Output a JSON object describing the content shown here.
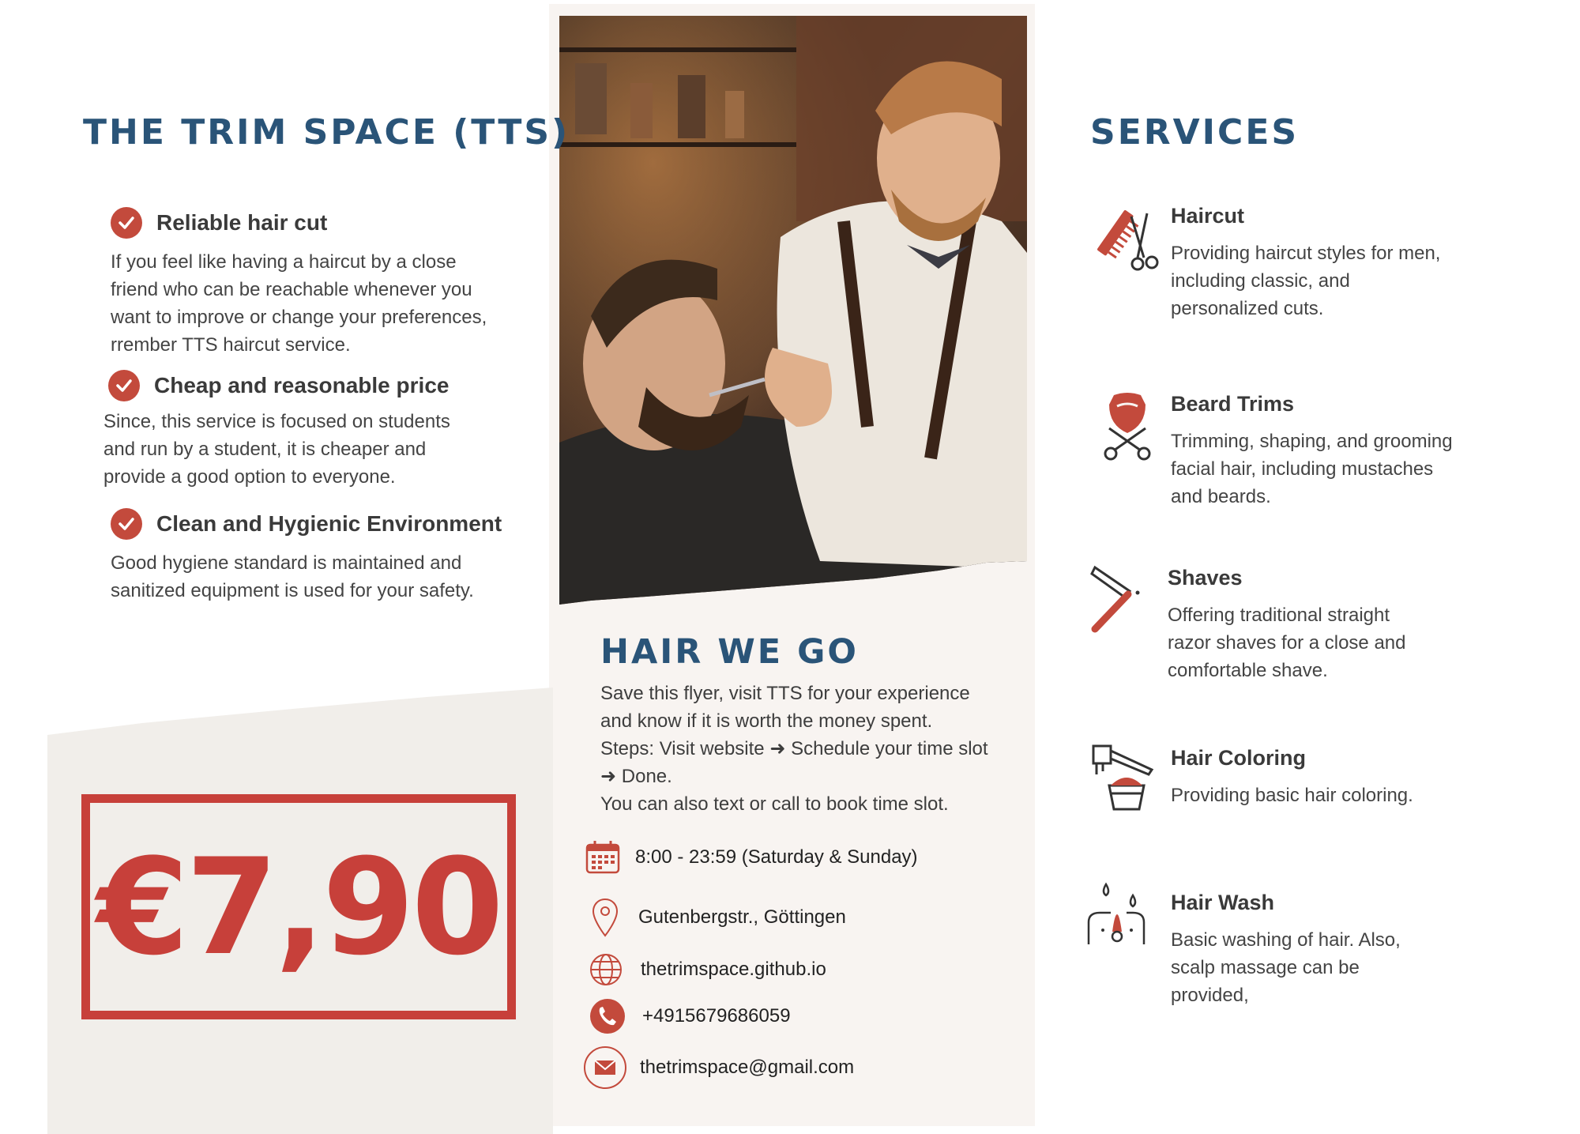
{
  "brand": {
    "title": "THE TRIM SPACE (TTS)"
  },
  "features": [
    {
      "title": "Reliable hair cut",
      "description": "If you feel like having a haircut by a close\nfriend who can be reachable whenever you\nwant to improve or change your preferences,\nrrember TTS haircut service."
    },
    {
      "title": "Cheap and reasonable price",
      "description": "Since, this service is focused on students\nand run by a student, it is cheaper and\nprovide a good option to everyone."
    },
    {
      "title": "Clean and Hygienic Environment",
      "description": "Good hygiene standard is maintained and\nsanitized equipment is used for your safety."
    }
  ],
  "price": "€7,90",
  "hair_we_go": {
    "title": "HAIR WE GO",
    "lines": [
      "Save this flyer, visit TTS for your experience",
      "and know if it is worth the money spent.",
      "Steps: Visit website ➜ Schedule your time slot",
      "➜  Done.",
      "You can also text or call to book time slot."
    ]
  },
  "contact": {
    "hours": "8:00 - 23:59 (Saturday & Sunday)",
    "address": "Gutenbergstr., Göttingen",
    "website": "thetrimspace.github.io",
    "phone": "+4915679686059",
    "email": "thetrimspace@gmail.com"
  },
  "services": {
    "title": "SERVICES",
    "items": [
      {
        "title": "Haircut",
        "icon": "comb-scissors-icon",
        "description": "Providing haircut styles for men,\nincluding classic, and\npersonalized cuts."
      },
      {
        "title": "Beard Trims",
        "icon": "beard-scissors-icon",
        "description": "Trimming, shaping, and grooming\nfacial hair, including mustaches\nand beards."
      },
      {
        "title": "Shaves",
        "icon": "straight-razor-icon",
        "description": "Offering traditional straight\nrazor shaves for a close and\ncomfortable shave."
      },
      {
        "title": "Hair Coloring",
        "icon": "hair-dye-brush-icon",
        "description": "Providing basic hair coloring."
      },
      {
        "title": "Hair Wash",
        "icon": "hair-wash-icon",
        "description": "Basic washing of hair. Also,\nscalp massage can be\nprovided,"
      }
    ]
  },
  "colors": {
    "accent": "#c7403a",
    "heading": "#2a5478",
    "panel": "#f8f4f1"
  }
}
